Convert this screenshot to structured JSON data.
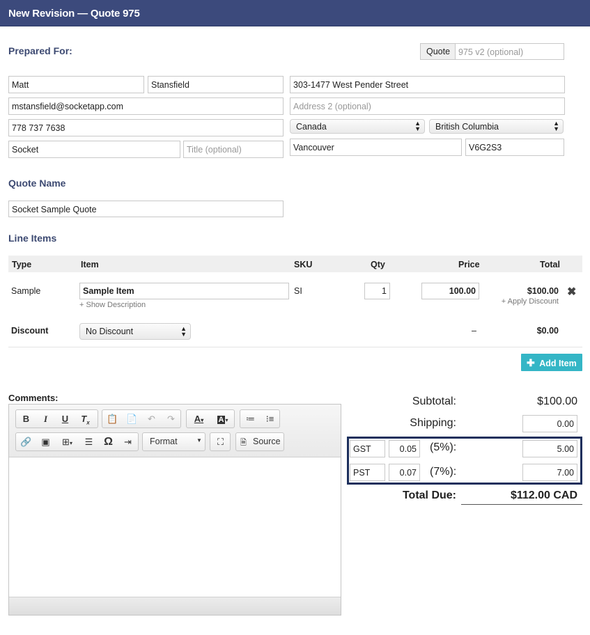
{
  "header": {
    "title": "New Revision — Quote 975"
  },
  "prepared_for": {
    "heading": "Prepared For:",
    "quote_addon": "Quote",
    "quote_placeholder": "975 v2 (optional)",
    "first_name": "Matt",
    "last_name": "Stansfield",
    "email": "mstansfield@socketapp.com",
    "phone": "778 737 7638",
    "company": "Socket",
    "title_placeholder": "Title (optional)",
    "address1": "303-1477 West Pender Street",
    "address2_placeholder": "Address 2 (optional)",
    "country": "Canada",
    "province": "British Columbia",
    "city": "Vancouver",
    "postal": "V6G2S3"
  },
  "quote_name": {
    "heading": "Quote Name",
    "value": "Socket Sample Quote"
  },
  "line_items": {
    "heading": "Line Items",
    "columns": {
      "type": "Type",
      "item": "Item",
      "sku": "SKU",
      "qty": "Qty",
      "price": "Price",
      "total": "Total"
    },
    "row": {
      "type": "Sample",
      "item": "Sample Item",
      "show_description": "+ Show Description",
      "sku": "SI",
      "qty": "1",
      "price": "100.00",
      "total": "$100.00",
      "apply_discount": "+ Apply Discount"
    },
    "discount": {
      "label": "Discount",
      "select": "No Discount",
      "dash": "–",
      "total": "$0.00"
    },
    "add_item": "Add Item"
  },
  "comments": {
    "label": "Comments:",
    "format_label": "Format",
    "source_label": "Source"
  },
  "totals": {
    "subtotal_label": "Subtotal:",
    "subtotal": "$100.00",
    "shipping_label": "Shipping:",
    "shipping": "0.00",
    "tax1": {
      "name": "GST",
      "rate": "0.05",
      "pct": "(5%):",
      "amount": "5.00"
    },
    "tax2": {
      "name": "PST",
      "rate": "0.07",
      "pct": "(7%):",
      "amount": "7.00"
    },
    "total_label": "Total Due:",
    "total": "$112.00 CAD"
  },
  "colors": {
    "header": "#3c4a7c",
    "heading": "#3d4a72",
    "add_button": "#34b6c6",
    "tax_highlight": "#1c2f5c"
  }
}
